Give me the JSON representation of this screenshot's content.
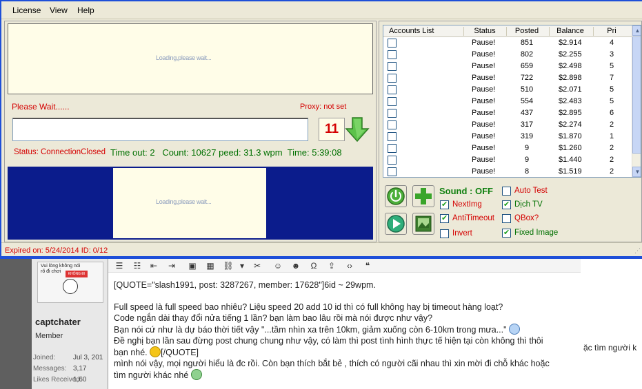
{
  "menu": [
    "License",
    "View",
    "Help"
  ],
  "captcha": {
    "loading_text": "Loading,please wait..."
  },
  "wait_label": "Please Wait......",
  "proxy_label": "Proxy: not set",
  "answer_input": {
    "value": "",
    "placeholder": ""
  },
  "counter": "11",
  "status_text": "Status: ConnectionClosed",
  "stats": {
    "timeout": "Time out: 2",
    "count": "Count: 10627",
    "speed": "peed: 31.3 wpm",
    "time": "Time: 5:39:08"
  },
  "grid": {
    "columns": [
      "Accounts List",
      "Status",
      "Posted",
      "Balance",
      "Pri"
    ],
    "rows": [
      {
        "status": "Pause!",
        "posted": "851",
        "balance": "$2.914",
        "pri": "4"
      },
      {
        "status": "Pause!",
        "posted": "802",
        "balance": "$2.255",
        "pri": "3"
      },
      {
        "status": "Pause!",
        "posted": "659",
        "balance": "$2.498",
        "pri": "5"
      },
      {
        "status": "Pause!",
        "posted": "722",
        "balance": "$2.898",
        "pri": "7"
      },
      {
        "status": "Pause!",
        "posted": "510",
        "balance": "$2.071",
        "pri": "5"
      },
      {
        "status": "Pause!",
        "posted": "554",
        "balance": "$2.483",
        "pri": "5"
      },
      {
        "status": "Pause!",
        "posted": "437",
        "balance": "$2.895",
        "pri": "6"
      },
      {
        "status": "Pause!",
        "posted": "317",
        "balance": "$2.274",
        "pri": "2"
      },
      {
        "status": "Pause!",
        "posted": "319",
        "balance": "$1.870",
        "pri": "1"
      },
      {
        "status": "Pause!",
        "posted": "9",
        "balance": "$1.260",
        "pri": "2"
      },
      {
        "status": "Pause!",
        "posted": "9",
        "balance": "$1.440",
        "pri": "2"
      },
      {
        "status": "Pause!",
        "posted": "8",
        "balance": "$1.519",
        "pri": "2"
      }
    ]
  },
  "controls": {
    "sound": "Sound : OFF",
    "next_img": {
      "label": "NextImg",
      "checked": true
    },
    "anti_timeout": {
      "label": "AntiTimeout",
      "checked": true
    },
    "invert": {
      "label": "Invert",
      "checked": false
    },
    "auto_test": {
      "label": "Auto Test",
      "checked": false
    },
    "dich_tv": {
      "label": "Dịch TV",
      "checked": true
    },
    "qbox": {
      "label": "QBox?",
      "checked": false
    },
    "fixed_image": {
      "label": "Fixed Image",
      "checked": true
    }
  },
  "statusbar": "Expired on: 5/24/2014  ID: 0/12",
  "forum": {
    "username": "captchater",
    "role": "Member",
    "stats": [
      {
        "label": "Joined:",
        "value": "Jul 3, 201"
      },
      {
        "label": "Messages:",
        "value": "3,17"
      },
      {
        "label": "Likes Received:",
        "value": "1,60"
      }
    ],
    "post_lines": [
      "[QUOTE=\"slash1991, post: 3287267, member: 17628\"]6id ~ 29wpm.",
      "Full speed là full speed bao nhiêu? Liệu speed 20 add 10 id thì có full không hay bị timeout hàng loạt?",
      "Code ngắn dài thay đổi nửa tiếng 1 lần? bạn làm bao lâu rồi mà nói được như vậy?",
      "Bạn nói cứ như là dự báo thời tiết vậy \"...tầm nhìn xa trên 10km, giảm xuống còn 6-10km trong mưa...\"",
      "Đề nghị bạn lần sau đừng post chung chung như vậy, có làm thì post tình hình thực tế hiện tại còn không thì thôi",
      "bạn nhé.",
      "[/QUOTE]",
      "mình nói vậy, mọi người hiểu là đc rồi. Còn bạn thích bắt bẻ , thích có người cãi nhau thì xin mời đi chỗ khác hoặc",
      "tìm người khác nhé"
    ],
    "side_text": "ặc tìm người k"
  }
}
